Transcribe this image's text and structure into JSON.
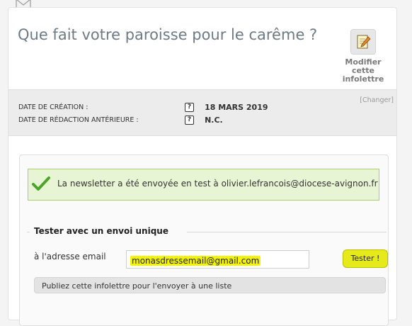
{
  "header": {
    "title": "Que fait votre paroisse pour le carême ?",
    "edit_button": {
      "lines": [
        "Modifier",
        "cette",
        "infolettre"
      ],
      "icon": "notepad-pencil-icon"
    },
    "envelope_icon": "envelope-icon"
  },
  "meta": {
    "change_link": "[Changer]",
    "rows": [
      {
        "label": "DATE DE CRÉATION :",
        "value": "18 MARS 2019"
      },
      {
        "label": "DATE DE RÉDACTION ANTÉRIEURE :",
        "value": "N.C."
      }
    ],
    "help_glyph": "?"
  },
  "notice": {
    "text": "La newsletter a été envoyée en test à olivier.lefrancois@diocese-avignon.fr",
    "icon": "checkmark-icon",
    "color": "#e8f5d4"
  },
  "test_form": {
    "section_title": "Tester avec un envoi unique",
    "email_label": "à l'adresse email",
    "email_value": "monasdressemail@gmail.com",
    "submit_label": "Tester !",
    "highlight_color": "#f4f400"
  },
  "publish": {
    "text": "Publiez cette infolettre pour l'envoyer à une liste"
  }
}
